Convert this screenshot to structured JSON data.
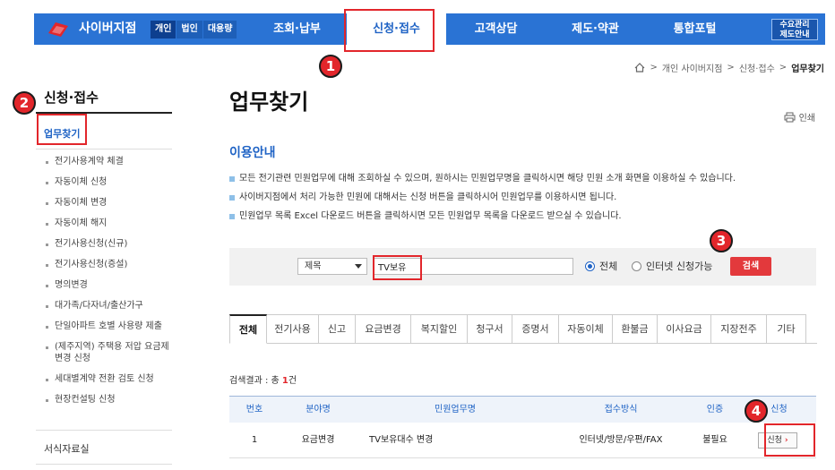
{
  "header": {
    "brand": "사이버지점",
    "segments": [
      "개인",
      "법인",
      "대용량"
    ],
    "gnb": [
      "조회·납부",
      "신청·접수",
      "고객상담",
      "제도·약관",
      "통합포털"
    ],
    "side_button_line1": "수요관리",
    "side_button_line2": "제도안내"
  },
  "breadcrumb": [
    "개인 사이버지점",
    "신청·접수",
    "업무찾기"
  ],
  "markers": [
    "1",
    "2",
    "3",
    "4"
  ],
  "lnb": {
    "title": "신청·접수",
    "selected": "업무찾기",
    "items": [
      "전기사용계약 체결",
      "자동이체 신청",
      "자동이체 변경",
      "자동이체 해지",
      "전기사용신청(신규)",
      "전기사용신청(증설)",
      "명의변경",
      "대가족/다자녀/출산가구",
      "단일아파트 호별 사용량 제출",
      "(제주지역) 주택용 저압 요금제 변경 신청",
      "세대별계약 전환 검토 신청",
      "현장컨설팅 신청"
    ],
    "footer_item": "서식자료실"
  },
  "main": {
    "title": "업무찾기",
    "print_label": "인쇄",
    "section_title": "이용안내",
    "guide": [
      "모든 전기관련 민원업무에 대해 조회하실 수 있으며, 원하시는 민원업무명을 클릭하시면 해당 민원 소개 화면을 이용하실 수 있습니다.",
      "사이버지점에서 처리 가능한 민원에 대해서는 신청 버튼을 클릭하시어 민원업무를 이용하시면 됩니다.",
      "민원업무 목록 Excel 다운로드 버튼을 클릭하시면 모든 민원업무 목록을 다운로드 받으실 수 있습니다."
    ]
  },
  "search": {
    "select_value": "제목",
    "input_value": "TV보유",
    "radio_all": "전체",
    "radio_online": "인터넷 신청가능",
    "button": "검색"
  },
  "tabs": [
    "전체",
    "전기사용",
    "신고",
    "요금변경",
    "복지할인",
    "청구서",
    "증명서",
    "자동이체",
    "환불금",
    "이사요금",
    "지장전주",
    "기타"
  ],
  "result": {
    "prefix": "검색결과 : 총 ",
    "count": "1",
    "suffix": "건"
  },
  "table": {
    "headers": [
      "번호",
      "분야명",
      "민원업무명",
      "접수방식",
      "인증",
      "신청"
    ],
    "rows": [
      {
        "no": "1",
        "field": "요금변경",
        "name": "TV보유대수 변경",
        "method": "인터넷/방문/우편/FAX",
        "auth": "불필요",
        "apply": "신청"
      }
    ]
  }
}
